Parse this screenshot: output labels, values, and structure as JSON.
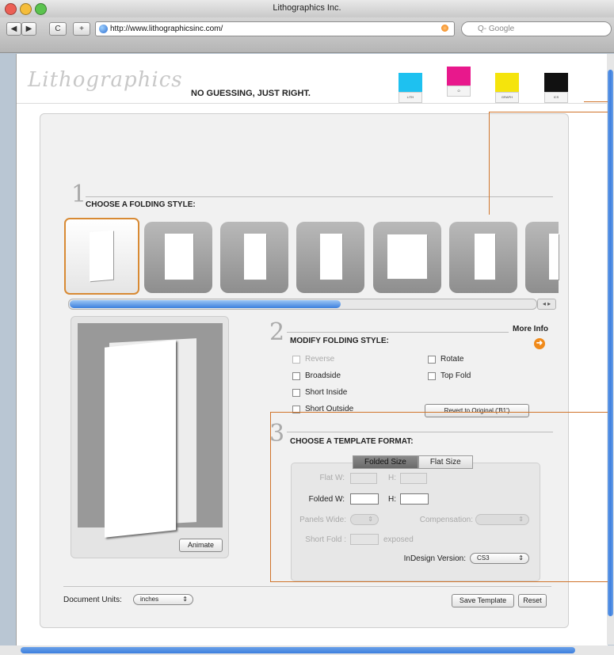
{
  "browser": {
    "title": "Lithographics Inc.",
    "url": "http://www.lithographicsinc.com/",
    "search_placeholder": "Q- Google",
    "back_label": "◀",
    "forward_label": "▶",
    "reload_label": "C",
    "add_label": "+"
  },
  "site": {
    "logo": "Lithographics",
    "tagline": "NO GUESSING, JUST RIGHT.",
    "swatches": [
      {
        "label": "LITH",
        "color": "#1ec1f0"
      },
      {
        "label": "O",
        "color": "#e8188c"
      },
      {
        "label": "GRAPH",
        "color": "#f5e40c"
      },
      {
        "label": "ICS",
        "color": "#111111"
      }
    ]
  },
  "step1": {
    "number": "1",
    "label": "CHOOSE A FOLDING STYLE:"
  },
  "step2": {
    "number": "2",
    "label": "MODIFY FOLDING STYLE:",
    "more_info": "More Info",
    "options_left": [
      {
        "label": "Reverse",
        "disabled": true
      },
      {
        "label": "Broadside",
        "disabled": false
      },
      {
        "label": "Short Inside",
        "disabled": false
      },
      {
        "label": "Short Outside",
        "disabled": false
      }
    ],
    "options_right": [
      {
        "label": "Rotate",
        "disabled": false
      },
      {
        "label": "Top Fold",
        "disabled": false
      }
    ],
    "revert_label": "Revert to Original ('B1')"
  },
  "preview": {
    "animate_label": "Animate"
  },
  "step3": {
    "number": "3",
    "label": "CHOOSE A TEMPLATE FORMAT:",
    "tabs": [
      "Folded Size",
      "Flat Size"
    ],
    "flat_w_label": "Flat W:",
    "h_label": "H:",
    "folded_w_label": "Folded W:",
    "panels_wide_label": "Panels Wide:",
    "compensation_label": "Compensation:",
    "short_fold_label": "Short Fold :",
    "exposed_label": "exposed",
    "indesign_label": "InDesign Version:",
    "indesign_value": "CS3"
  },
  "footer": {
    "units_label": "Document Units:",
    "units_value": "inches",
    "save_label": "Save Template",
    "reset_label": "Reset"
  }
}
